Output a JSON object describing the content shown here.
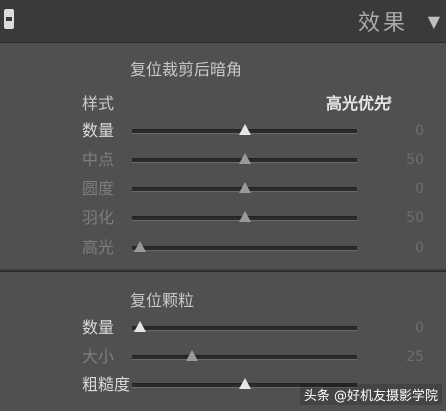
{
  "panel": {
    "title": "效果",
    "collapse_glyph": "▼",
    "toggle_icon": "panel-toggle-icon"
  },
  "vignette": {
    "title": "复位裁剪后暗角",
    "style_label": "样式",
    "style_value": "高光优先",
    "style_arrows": "⬍",
    "sliders": [
      {
        "label": "数量",
        "value": "0",
        "level": 0.5,
        "active": true
      },
      {
        "label": "中点",
        "value": "50",
        "level": 0.5,
        "active": false
      },
      {
        "label": "圆度",
        "value": "0",
        "level": 0.5,
        "active": false
      },
      {
        "label": "羽化",
        "value": "50",
        "level": 0.5,
        "active": false
      },
      {
        "label": "高光",
        "value": "0",
        "level": 0.0,
        "active": false
      }
    ]
  },
  "grain": {
    "title": "复位颗粒",
    "sliders": [
      {
        "label": "数量",
        "value": "0",
        "level": 0.0,
        "active": true
      },
      {
        "label": "大小",
        "value": "25",
        "level": 0.25,
        "active": false
      },
      {
        "label": "粗糙度",
        "value": "",
        "level": 0.5,
        "active": true
      }
    ]
  },
  "watermark": "头条 @好机友摄影学院"
}
